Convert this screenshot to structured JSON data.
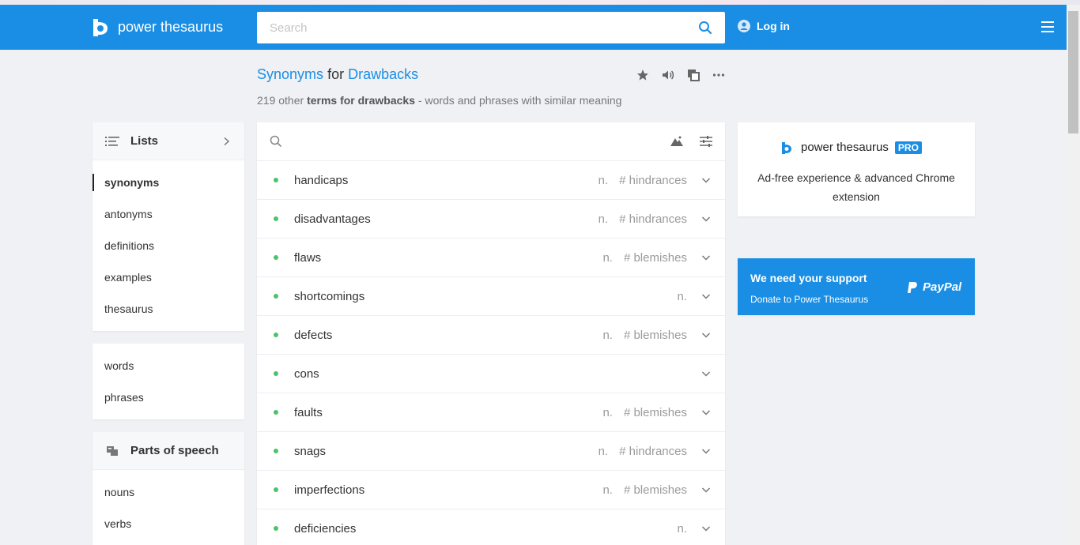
{
  "header": {
    "logo_text": "power thesaurus",
    "search_placeholder": "Search",
    "login_label": "Log in"
  },
  "page": {
    "title_prefix": "Synonyms",
    "title_for": "for",
    "title_term": "Drawbacks",
    "subtitle_count": "219 other",
    "subtitle_bold": "terms for drawbacks",
    "subtitle_rest": "- words and phrases with similar meaning"
  },
  "sidebar": {
    "lists_label": "Lists",
    "list_items": [
      "synonyms",
      "antonyms",
      "definitions",
      "examples",
      "thesaurus"
    ],
    "type_items": [
      "words",
      "phrases"
    ],
    "pos_label": "Parts of speech",
    "pos_items": [
      "nouns",
      "verbs"
    ]
  },
  "results": [
    {
      "word": "handicaps",
      "pos": "n.",
      "tag": "# hindrances"
    },
    {
      "word": "disadvantages",
      "pos": "n.",
      "tag": "# hindrances"
    },
    {
      "word": "flaws",
      "pos": "n.",
      "tag": "# blemishes"
    },
    {
      "word": "shortcomings",
      "pos": "n.",
      "tag": ""
    },
    {
      "word": "defects",
      "pos": "n.",
      "tag": "# blemishes"
    },
    {
      "word": "cons",
      "pos": "",
      "tag": ""
    },
    {
      "word": "faults",
      "pos": "n.",
      "tag": "# blemishes"
    },
    {
      "word": "snags",
      "pos": "n.",
      "tag": "# hindrances"
    },
    {
      "word": "imperfections",
      "pos": "n.",
      "tag": "# blemishes"
    },
    {
      "word": "deficiencies",
      "pos": "n.",
      "tag": ""
    }
  ],
  "pro": {
    "brand": "power thesaurus",
    "badge": "PRO",
    "description": "Ad-free experience & advanced Chrome extension"
  },
  "support": {
    "title": "We need your support",
    "subtitle": "Donate to Power Thesaurus",
    "paypal_label": "PayPal"
  },
  "colors": {
    "brand_blue": "#1a8ee4",
    "dot_green": "#4cc36a"
  }
}
